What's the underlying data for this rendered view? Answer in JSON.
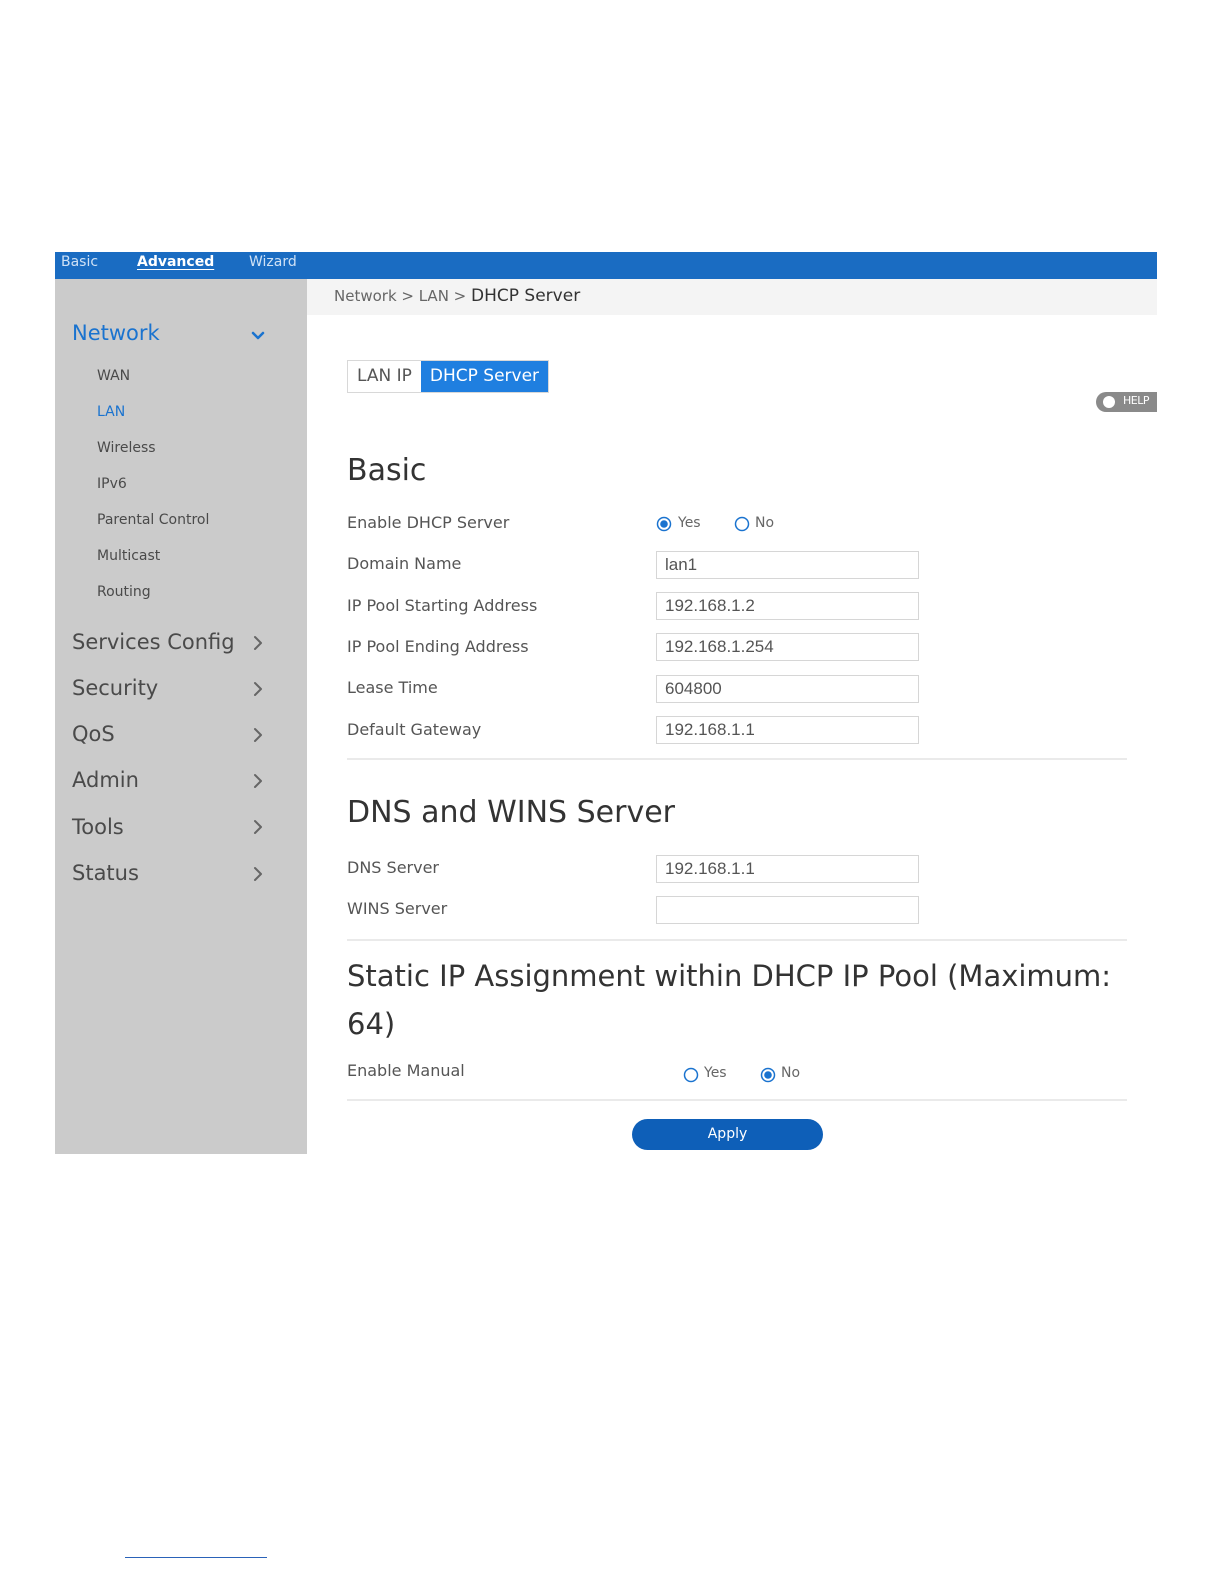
{
  "topnav": {
    "tabs": [
      "Basic",
      "Advanced",
      "Wizard"
    ],
    "active": "Advanced"
  },
  "sidebar": {
    "network": "Network",
    "network_items": [
      "WAN",
      "LAN",
      "Wireless",
      "IPv6",
      "Parental Control",
      "Multicast",
      "Routing"
    ],
    "active_item": "LAN",
    "sections": [
      "Services Config",
      "Security",
      "QoS",
      "Admin",
      "Tools",
      "Status"
    ]
  },
  "breadcrumb": {
    "path": "Network > LAN > ",
    "current": "DHCP Server"
  },
  "tabs": {
    "lan_ip": "LAN IP",
    "dhcp_server": "DHCP Server"
  },
  "help_label": "HELP",
  "basic": {
    "title": "Basic",
    "enable_label": "Enable DHCP Server",
    "yes": "Yes",
    "no": "No",
    "enable_selected": "Yes",
    "fields": [
      {
        "label": "Domain Name",
        "value": "lan1"
      },
      {
        "label": "IP Pool Starting Address",
        "value": "192.168.1.2"
      },
      {
        "label": "IP Pool Ending Address",
        "value": "192.168.1.254"
      },
      {
        "label": "Lease Time",
        "value": "604800"
      },
      {
        "label": "Default Gateway",
        "value": "192.168.1.1"
      }
    ]
  },
  "dns": {
    "title": "DNS and WINS Server",
    "fields": [
      {
        "label": "DNS Server",
        "value": "192.168.1.1"
      },
      {
        "label": "WINS Server",
        "value": ""
      }
    ]
  },
  "static": {
    "title": "Static IP Assignment within DHCP IP Pool (Maximum: 64)",
    "enable_label": "Enable Manual",
    "yes": "Yes",
    "no": "No",
    "enable_selected": "No"
  },
  "apply_label": "Apply",
  "colors": {
    "topbar": "#1a6cc2",
    "sidebar": "#cbcbcb",
    "accent": "#1f7fe0",
    "apply": "#0e5fb8"
  }
}
